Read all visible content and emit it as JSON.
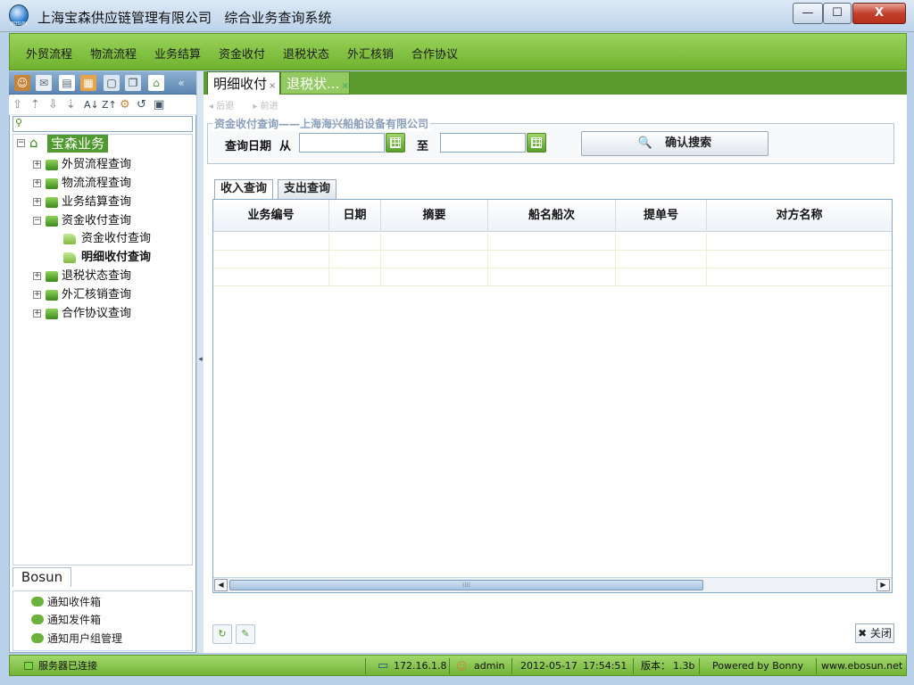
{
  "window": {
    "app_name": "上海宝森供应链管理有限公司",
    "subtitle": "综合业务查询系统",
    "logo_text": "BOSUN",
    "min_label": "—",
    "max_label": "☐",
    "close_label": "X"
  },
  "menu": {
    "items": [
      {
        "label": "外贸流程"
      },
      {
        "label": "物流流程"
      },
      {
        "label": "业务结算"
      },
      {
        "label": "资金收付"
      },
      {
        "label": "退税状态"
      },
      {
        "label": "外汇核销"
      },
      {
        "label": "合作协议"
      }
    ]
  },
  "left_toolbar": {
    "collapse_label": "«"
  },
  "tree": {
    "root": {
      "label": "宝森业务"
    },
    "items": [
      {
        "label": "外贸流程查询"
      },
      {
        "label": "物流流程查询"
      },
      {
        "label": "业务结算查询"
      },
      {
        "label": "资金收付查询"
      },
      {
        "label": "资金收付查询"
      },
      {
        "label": "明细收付查询"
      },
      {
        "label": "退税状态查询"
      },
      {
        "label": "外汇核销查询"
      },
      {
        "label": "合作协议查询"
      }
    ]
  },
  "bosun": {
    "tab_label": "Bosun",
    "items": [
      {
        "label": "通知收件箱"
      },
      {
        "label": "通知发件箱"
      },
      {
        "label": "通知用户组管理"
      }
    ]
  },
  "tabs": [
    {
      "label": "明细收付",
      "close": "×"
    },
    {
      "label": "退税状...",
      "close": "×"
    }
  ],
  "content": {
    "nav_back": "◂ 后退",
    "nav_forward": "▸ 前进",
    "legend": "资金收付查询——上海海兴船舶设备有限公司",
    "date_label": "查询日期",
    "from_label": "从",
    "to_label": "至",
    "date_from_value": "",
    "date_to_value": "",
    "search_label": "确认搜索",
    "search_icon": "🔍",
    "subtabs": [
      {
        "label": "收入查询"
      },
      {
        "label": "支出查询"
      }
    ],
    "columns": [
      {
        "label": "业务编号"
      },
      {
        "label": "日期"
      },
      {
        "label": "摘要"
      },
      {
        "label": "船名船次"
      },
      {
        "label": "提单号"
      },
      {
        "label": "对方名称"
      }
    ],
    "scroll_left": "◀",
    "scroll_right": "▶",
    "scroll_grip": "⁞⁞⁞⁞",
    "refresh_icon": "↻",
    "export_icon": "✎",
    "close_label": "✖ 关闭"
  },
  "status": {
    "server": "服务器已连接",
    "ip": "172.16.1.8",
    "user": "admin",
    "date": "2012-05-17",
    "time": "17:54:51",
    "version_label": "版本：",
    "version": "1.3b",
    "powered": "Powered by Bonny",
    "website": "www.ebosun.net"
  },
  "colors": {
    "accent_green": "#6fb22e",
    "tree_root_bg": "#4f9a2e",
    "window_blue": "#b9d2e9"
  }
}
